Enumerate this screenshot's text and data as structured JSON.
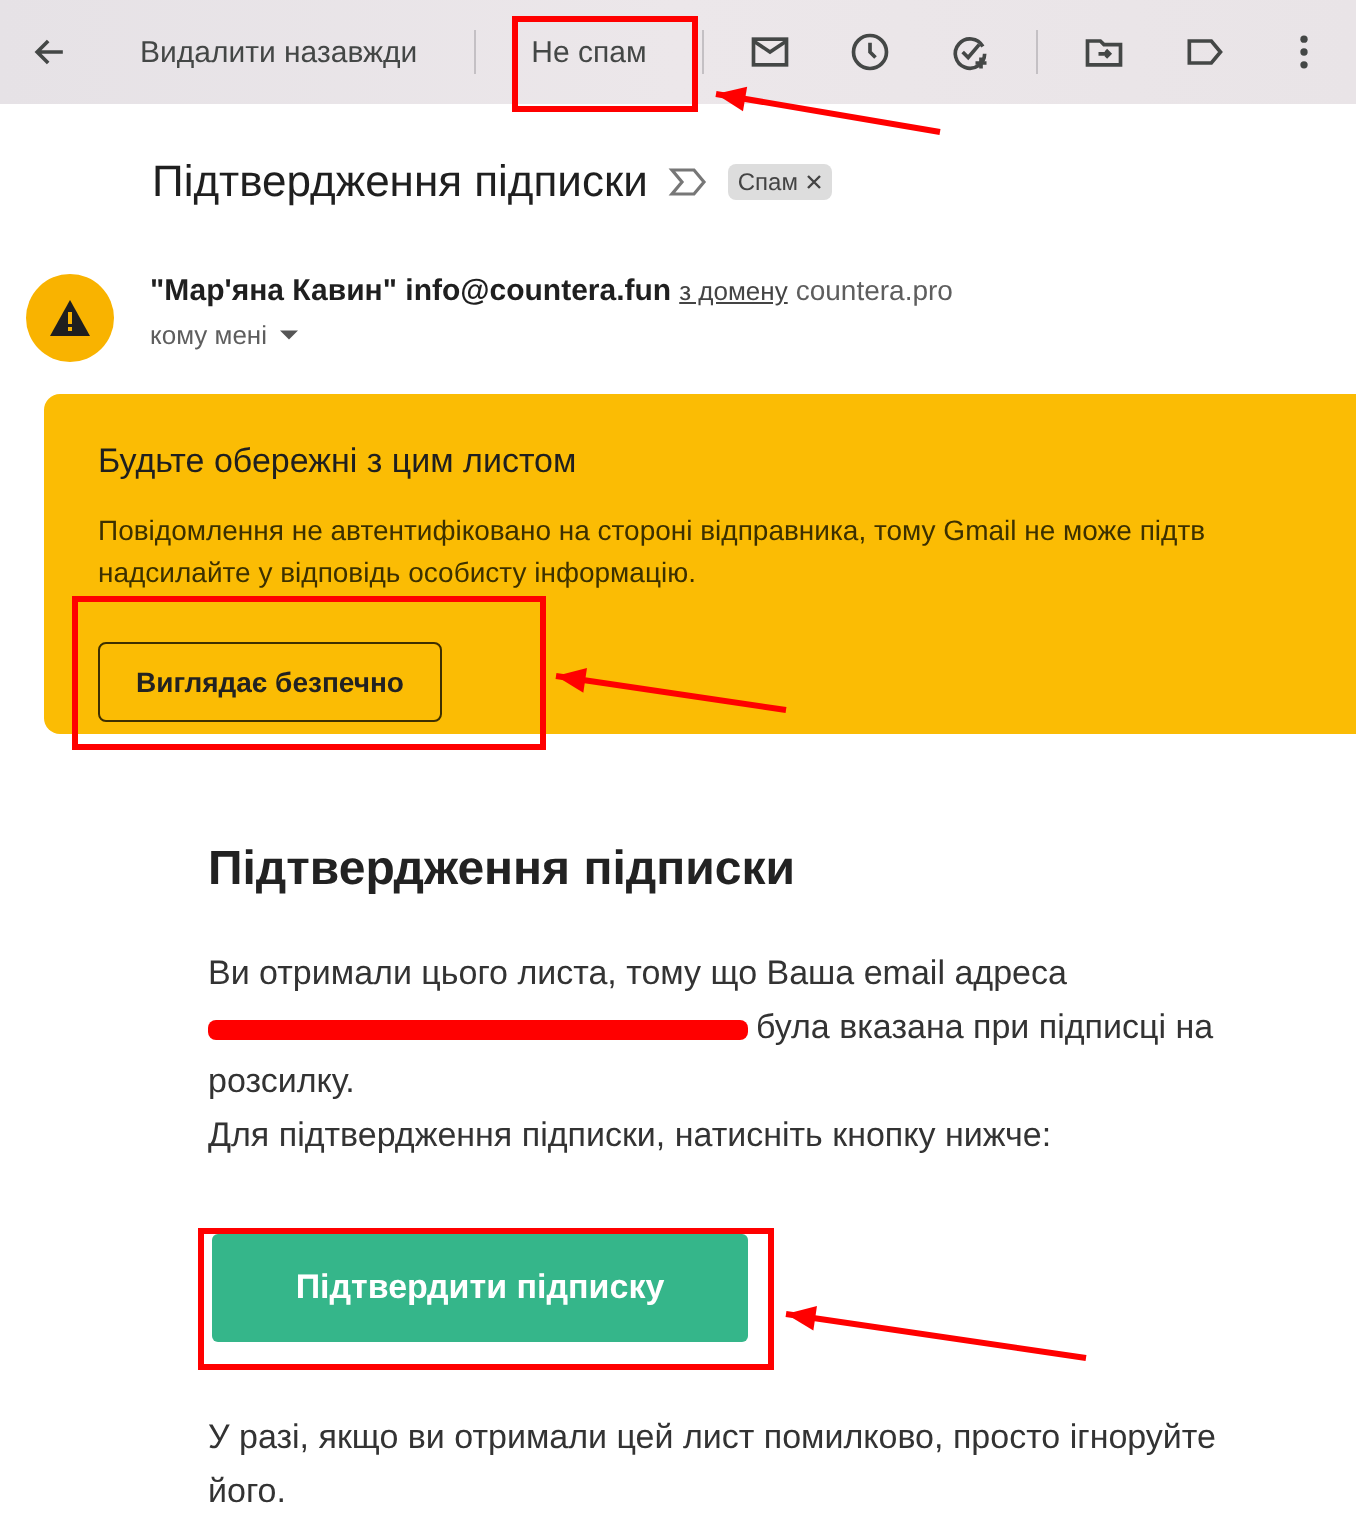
{
  "toolbar": {
    "actions": [
      {
        "kind": "back"
      },
      {
        "kind": "text",
        "label": "Видалити назавжди"
      },
      {
        "kind": "divider"
      },
      {
        "kind": "text",
        "label": "Не спам"
      },
      {
        "kind": "divider"
      },
      {
        "kind": "mail"
      },
      {
        "kind": "clock"
      },
      {
        "kind": "task"
      },
      {
        "kind": "divider"
      },
      {
        "kind": "move"
      },
      {
        "kind": "label"
      },
      {
        "kind": "more"
      }
    ]
  },
  "subject": {
    "title": "Підтвердження підписки",
    "labels": [
      {
        "text": "Спам",
        "removable": true
      }
    ]
  },
  "sender": {
    "name": "\"Мар'яна Кавин\" info@countera.fun",
    "via_link": "з домену",
    "domain": "countera.pro",
    "recipient": "кому мені"
  },
  "warning": {
    "title": "Будьте обережні з цим листом",
    "lines": [
      "Повідомлення не автентифіковано на стороні відправника, тому Gmail не може підтв",
      "надсилайте у відповідь особисту інформацію."
    ],
    "button": "Виглядає безпечно"
  },
  "body": {
    "heading": "Підтвердження підписки",
    "paragraph_before": "Ви отримали цього листа, тому що Ваша email адреса",
    "paragraph_after": "була вказана при підписці на розсилку.",
    "instruction": "Для підтвердження підписки, натисніть кнопку нижче:",
    "button": "Підтвердити підписку",
    "footer": "У разі, якщо ви отримали цей лист помилково, просто ігноруйте його."
  }
}
